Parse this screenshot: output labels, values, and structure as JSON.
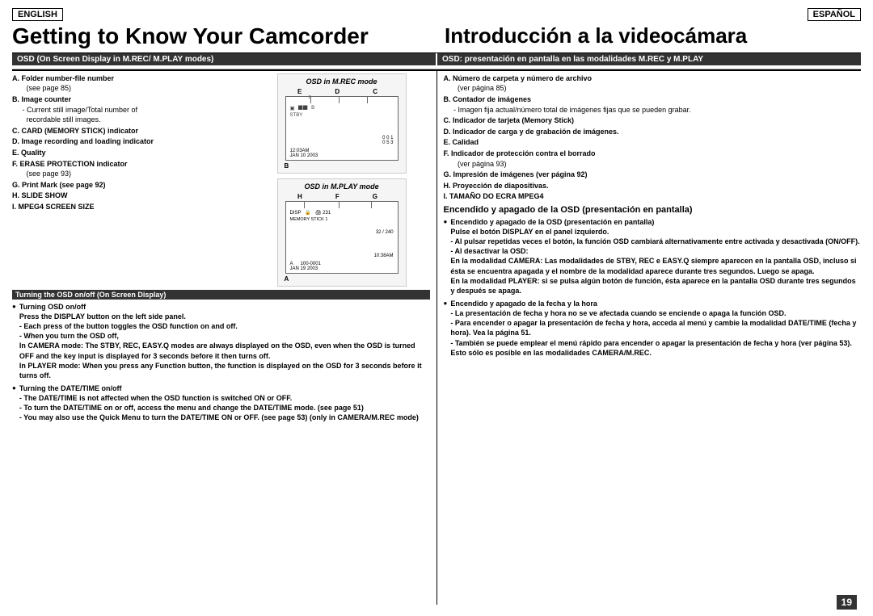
{
  "header": {
    "lang_en": "ENGLISH",
    "lang_es": "ESPAÑOL",
    "title_en": "Getting to Know Your Camcorder",
    "title_es": "Introducción a la videocámara"
  },
  "osd_header_en": "OSD (On Screen Display in M.REC/ M.PLAY modes)",
  "osd_header_es": "OSD: presentación en pantalla en las modalidades M.REC y M.PLAY",
  "osd_mrec_title": "OSD in M.REC mode",
  "osd_mplay_title": "OSD in M.PLAY mode",
  "section_turning": "Turning the OSD on/off (On Screen Display)",
  "items_en": [
    {
      "label": "A. Folder number-file number",
      "sub": "(see page 85)"
    },
    {
      "label": "B. Image counter"
    },
    {
      "sub": "- Current still image/Total number of recordable still images."
    },
    {
      "label": "C. CARD (MEMORY STICK) indicator"
    },
    {
      "label": "D. Image recording and loading indicator"
    },
    {
      "label": "E. Quality"
    },
    {
      "label": "F. ERASE PROTECTION indicator",
      "sub": "(see page 93)"
    },
    {
      "label": "G. Print Mark (see page 92)"
    },
    {
      "label": "H. SLIDE SHOW"
    },
    {
      "label": "I. MPEG4 SCREEN SIZE"
    }
  ],
  "items_es": [
    {
      "label": "A. Número de carpeta y número de archivo",
      "sub": "(ver página 85)"
    },
    {
      "label": "B. Contador de imágenes"
    },
    {
      "sub": "- Imagen fija actual/número total de imágenes fijas que se pueden grabar."
    },
    {
      "label": "C. Indicador de tarjeta (Memory Stick)"
    },
    {
      "label": "D. Indicador de carga y de grabación de imágenes."
    },
    {
      "label": "E. Calidad"
    },
    {
      "label": "F. Indicador de protección contra el borrado",
      "sub": "(ver página 93)"
    },
    {
      "label": "G. Impresión de imágenes (ver página 92)"
    },
    {
      "label": "H. Proyección de diapositivas."
    },
    {
      "label": "I. TAMAÑO DO ECRA MPEG4"
    }
  ],
  "turning_osd_title_en": "● Turning OSD on/off",
  "turning_osd_body_en": [
    "Press the DISPLAY button on the left side panel.",
    "- Each press of the button toggles the OSD function on and off.",
    "- When you turn the OSD off,"
  ],
  "in_camera_mode_en": "In CAMERA mode: The STBY, REC, EASY.Q modes are always displayed on the OSD, even when the OSD is turned OFF and the key input is displayed for 3 seconds before it then turns off.",
  "in_player_mode_en": "In PLAYER mode: When you press any Function button, the function is displayed on the OSD for 3 seconds before it turns off.",
  "turning_date_title_en": "● Turning the DATE/TIME on/off",
  "turning_date_body_en": [
    "- The DATE/TIME is not affected when the OSD function is switched ON or OFF.",
    "- To turn the DATE/TIME on or off, access the menu and change the DATE/TIME mode. (see page 51)",
    "- You may also use the Quick Menu to turn the DATE/TIME ON or OFF. (see page 53) (only in CAMERA/M.REC mode)"
  ],
  "encendido_osd_title_es": "● Encendido y apagado de la OSD (presentación en pantalla)",
  "encendido_osd_body_es": [
    "Pulse el botón DISPLAY en el panel izquierdo.",
    "- Al pulsar repetidas veces el botón, la función OSD cambiará alternativamente entre activada y desactivada (ON/OFF).",
    "- Al desactivar la OSD:"
  ],
  "en_modalidad_camera_es": "En la modalidad CAMERA: Las modalidades de STBY, REC e EASY.Q siempre aparecen en la pantalla OSD, incluso si ésta se encuentra apagada y el nombre de la modalidad aparece durante tres segundos. Luego se apaga.",
  "en_modalidad_player_es": "En la modalidad PLAYER: si se pulsa algún botón de función, ésta aparece en la pantalla OSD durante tres segundos y después se apaga.",
  "encendido_fecha_title_es": "● Encendido y apagado de la fecha y la hora",
  "encendido_fecha_body_es": [
    "- La presentación de fecha y hora no se ve afectada cuando se enciende o apaga la función OSD.",
    "- Para encender o apagar la presentación de fecha y hora, acceda al menú y cambie la modalidad DATE/TIME (fecha y hora). Vea la página 51.",
    "- También se puede emplear el menú rápido para encender o apagar la presentación de fecha y hora (ver página 53). Esto sólo es posible en las modalidades CAMERA/M.REC."
  ],
  "page_number": "19",
  "screen1_letters": [
    "E",
    "D",
    "C"
  ],
  "screen2_letters": [
    "H",
    "F",
    "G"
  ],
  "screen1_bottom": "B",
  "screen2_bottom": "A",
  "screen1_date": "JAN 10 2003",
  "screen2_date": "JAN 19 2003",
  "screen1_time": "12:03AM",
  "screen2_time": "10:38AM"
}
